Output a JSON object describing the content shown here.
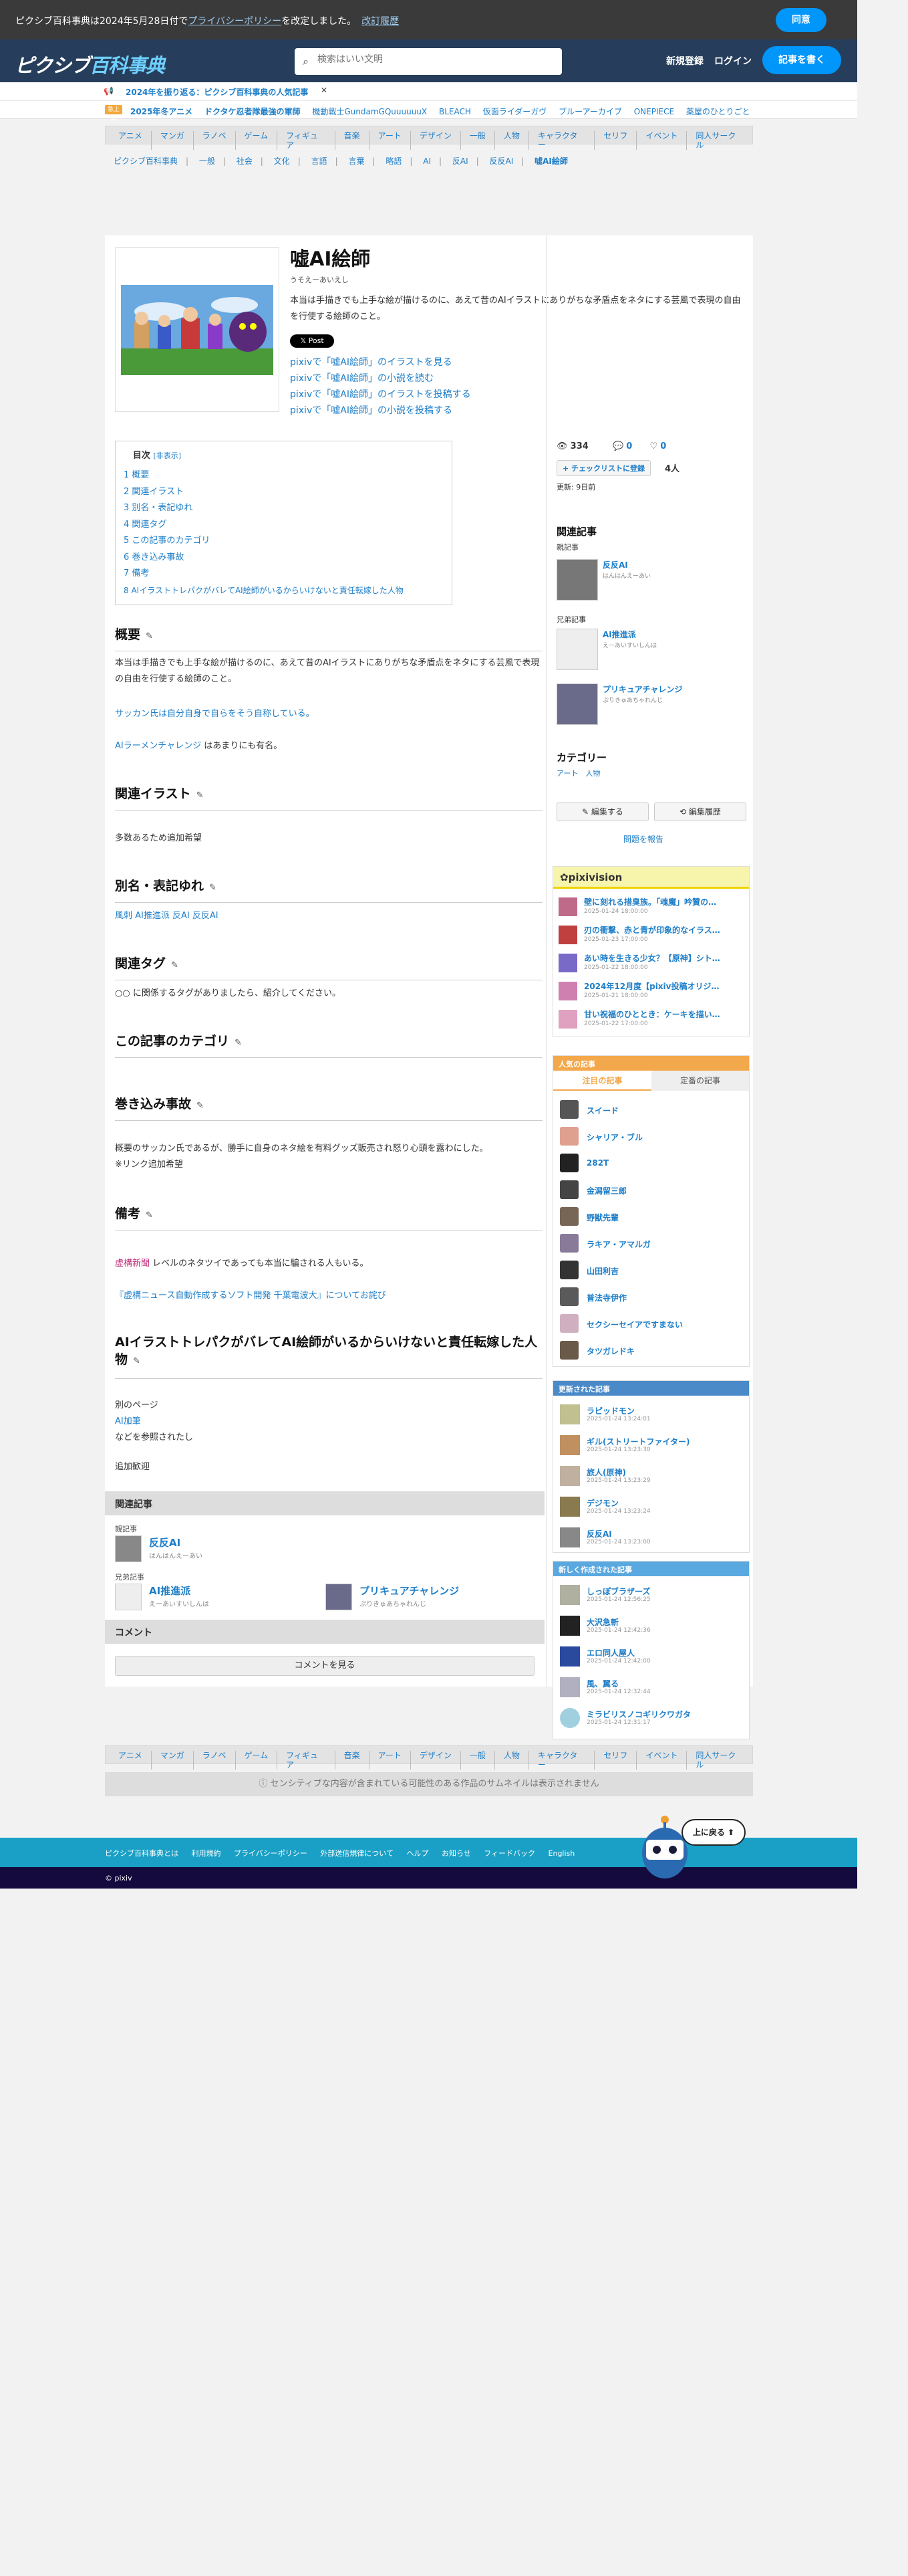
{
  "notice": {
    "prefix": "ピクシブ百科事典は2024年5月28日付で",
    "policy_link": "プライバシーポリシー",
    "suffix": "を改定しました。",
    "history_link": "改訂履歴",
    "agree": "同意"
  },
  "header": {
    "logo_latin": "ピクシブ",
    "logo_ja": "百科事典",
    "search_placeholder": "検索はいい文明",
    "register": "新規登録",
    "login": "ログイン",
    "write": "記事を書く"
  },
  "trend": {
    "title": "2024年を振り返る：ピクシブ百科事典の人気記事",
    "close": "✕"
  },
  "trend_tags": {
    "badge": "急上昇",
    "items": [
      "2025年冬アニメ",
      "ドクタケ忍者隊最強の軍師",
      "機動戦士GundamGQuuuuuuX",
      "BLEACH",
      "仮面ライダーガヴ",
      "ブルーアーカイブ",
      "ONEPIECE",
      "薬屋のひとりごと"
    ]
  },
  "categories": [
    "アニメ",
    "マンガ",
    "ラノベ",
    "ゲーム",
    "フィギュア",
    "音楽",
    "アート",
    "デザイン",
    "一般",
    "人物",
    "キャラクター",
    "セリフ",
    "イベント",
    "同人サークル"
  ],
  "breadcrumb": [
    "ピクシブ百科事典",
    "一般",
    "社会",
    "文化",
    "言語",
    "言葉",
    "略語",
    "AI",
    "反AI",
    "反反AI",
    "嘘AI絵師"
  ],
  "article": {
    "title": "嘘AI絵師",
    "reading": "うそえーあいえし",
    "lead": "本当は手描きでも上手な絵が描けるのに、あえて昔のAIイラストにありがちな矛盾点をネタにする芸風で表現の自由を行使する絵師のこと。",
    "xpost": "𝕏 Post",
    "pixiv_links": [
      "pixivで「嘘AI絵師」のイラストを見る",
      "pixivで「嘘AI絵師」の小説を読む",
      "pixivで「嘘AI絵師」のイラストを投稿する",
      "pixivで「嘘AI絵師」の小説を投稿する"
    ]
  },
  "toc": {
    "title": "目次",
    "toggle": "[非表示]",
    "items": [
      "1 概要",
      "2 関連イラスト",
      "3 別名・表記ゆれ",
      "4 関連タグ",
      "5 この記事のカテゴリ",
      "6 巻き込み事故",
      "7 備考",
      "8 AIイラストトレパクがバレてAI絵師がいるからいけないと責任転嫁した人物"
    ]
  },
  "sections": {
    "gaiyou": {
      "h": "概要",
      "p1": "本当は手描きでも上手な絵が描けるのに、あえて昔のAIイラストにありがちな矛盾点をネタにする芸風で表現の自由を行使する絵師のこと。",
      "p2": "サッカン氏は自分自身で自らをそう自称している。",
      "p3": "AIラーメンチャレンジ",
      "p3b": " はあまりにも有名。"
    },
    "illust": {
      "h": "関連イラスト",
      "p": "多数あるため追加希望"
    },
    "alias": {
      "h": "別名・表記ゆれ",
      "p": "風刺 AI推進派 反AI 反反AI"
    },
    "tags": {
      "h": "関連タグ",
      "p": "○○ に関係するタグがありましたら、紹介してください。"
    },
    "cat": {
      "h": "この記事のカテゴリ"
    },
    "jiko": {
      "h": "巻き込み事故",
      "p1": "概要のサッカン氏であるが、勝手に自身のネタ絵を有料グッズ販売され怒り心頭を露わにした。",
      "p2": "※リンク追加希望"
    },
    "biko": {
      "h": "備考",
      "p1a": "虚構新聞",
      "p1b": " レベルのネタツイであっても本当に騙される人もいる。",
      "p2": "『虚構ニュース自動作成するソフト開発 千葉電波大』についてお詫び"
    },
    "trepaku": {
      "h": "AIイラストトレパクがバレてAI絵師がいるからいけないと責任転嫁した人物",
      "p1": "別のページ",
      "p2": "AI加筆",
      "p3": "などを参照されたし",
      "p4": "追加歓迎"
    }
  },
  "related_bottom": {
    "title": "関連記事",
    "parent_label": "親記事",
    "parent": {
      "title": "反反AI",
      "kana": "はんはんえーあい"
    },
    "sibling_label": "兄弟記事",
    "siblings": [
      {
        "title": "AI推進派",
        "kana": "えーあいすいしんは"
      },
      {
        "title": "プリキュアチャレンジ",
        "kana": "ぷりきゅあちゃれんじ"
      }
    ],
    "comment": "コメント",
    "comment_btn": "コメントを見る"
  },
  "sidebar": {
    "views": "334",
    "comments": "0",
    "likes": "0",
    "checklist": "チェックリストに登録",
    "check_count": "4人",
    "updated": "更新: 9日前",
    "related_title": "関連記事",
    "parent_label": "親記事",
    "parent": {
      "title": "反反AI",
      "kana": "はんはんえーあい"
    },
    "sibling_label": "兄弟記事",
    "siblings": [
      {
        "title": "AI推進派",
        "kana": "えーあいすいしんは"
      },
      {
        "title": "プリキュアチャレンジ",
        "kana": "ぷりきゅあちゃれんじ"
      }
    ],
    "category_title": "カテゴリー",
    "category_items": [
      "アート",
      "人物"
    ],
    "edit": "編集する",
    "history": "編集履歴",
    "report": "問題を報告"
  },
  "pixivision": {
    "title": "pixivision",
    "items": [
      {
        "t": "壁に刻れる措臭族。「魂魔」吟贊の…",
        "d": "2025-01-24 18:00:00"
      },
      {
        "t": "刃の衝撃、赤と青が印象的なイラス…",
        "d": "2025-01-23 17:00:00"
      },
      {
        "t": "あい時を生きる少女？【原神】シト…",
        "d": "2025-01-22 18:00:00"
      },
      {
        "t": "2024年12月度【pixiv投稿オリジ…",
        "d": "2025-01-21 18:00:00"
      },
      {
        "t": "甘い祝福のひととき：ケーキを描い…",
        "d": "2025-01-22 17:00:00"
      }
    ]
  },
  "popular": {
    "title": "人気の記事",
    "tab1": "注目の記事",
    "tab2": "定番の記事",
    "items": [
      "スイード",
      "シャリア・ブル",
      "282T",
      "金潟留三郎",
      "野獣先輩",
      "ラキア・アマルガ",
      "山田利吉",
      "普法寺伊作",
      "セクシーセイアですまない",
      "タツガレドキ"
    ]
  },
  "updated_articles": {
    "title": "更新された記事",
    "items": [
      {
        "n": "ラピッドモン",
        "d": "2025-01-24 13:24:01"
      },
      {
        "n": "ギル(ストリートファイター)",
        "d": "2025-01-24 13:23:30"
      },
      {
        "n": "旅人(原神)",
        "d": "2025-01-24 13:23:29"
      },
      {
        "n": "デジモン",
        "d": "2025-01-24 13:23:24"
      },
      {
        "n": "反反AI",
        "d": "2025-01-24 13:23:00"
      }
    ]
  },
  "new_articles": {
    "title": "新しく作成された記事",
    "items": [
      {
        "n": "しっぽブラザーズ",
        "d": "2025-01-24 12:56:25"
      },
      {
        "n": "大沢急斬",
        "d": "2025-01-24 12:42:36"
      },
      {
        "n": "エロ同人屋人",
        "d": "2025-01-24 12:42:00"
      },
      {
        "n": "風、翼る",
        "d": "2025-01-24 12:32:44"
      },
      {
        "n": "ミラビリスノコギリクワガタ",
        "d": "2025-01-24 12:31:17"
      }
    ]
  },
  "sensitive": "センシティブな内容が含まれている可能性のある作品のサムネイルは表示されません",
  "footer": {
    "links": [
      "ピクシブ百科事典とは",
      "利用規約",
      "プライバシーポリシー",
      "外部送信規律について",
      "ヘルプ",
      "お知らせ",
      "フィードバック",
      "English"
    ],
    "copyright": "© pixiv",
    "to_top": "上に戻る ⬆"
  }
}
